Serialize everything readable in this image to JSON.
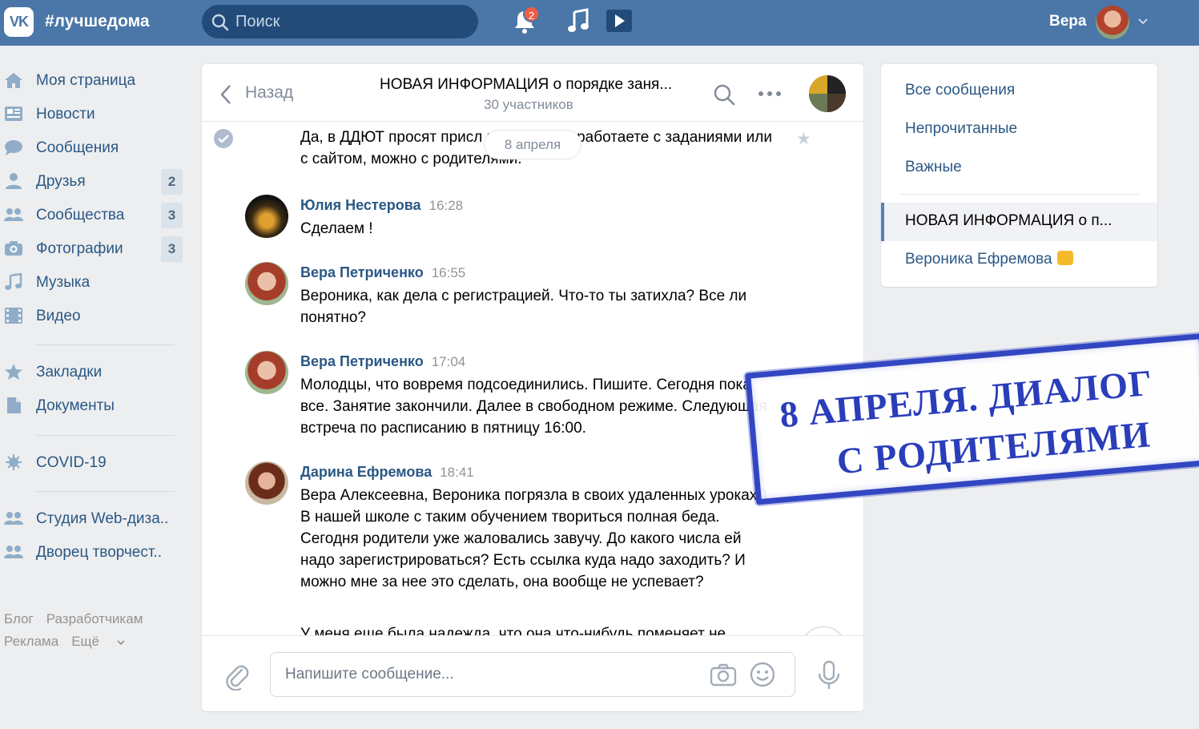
{
  "header": {
    "brand": "#лучшедома",
    "search_placeholder": "Поиск",
    "notifications_count": "2",
    "user_name": "Вера",
    "colors": {
      "bar": "#4a76a8",
      "search_bg": "#224b7a",
      "badge": "#f05c44"
    }
  },
  "sidebar": {
    "items": [
      {
        "label": "Моя страница",
        "icon": "home-icon"
      },
      {
        "label": "Новости",
        "icon": "news-icon"
      },
      {
        "label": "Сообщения",
        "icon": "chat-bubble-icon"
      },
      {
        "label": "Друзья",
        "icon": "person-icon",
        "count": "2"
      },
      {
        "label": "Сообщества",
        "icon": "group-icon",
        "count": "3"
      },
      {
        "label": "Фотографии",
        "icon": "camera-icon",
        "count": "3"
      },
      {
        "label": "Музыка",
        "icon": "music-icon"
      },
      {
        "label": "Видео",
        "icon": "video-film-icon"
      },
      {
        "label": "Закладки",
        "icon": "star-icon"
      },
      {
        "label": "Документы",
        "icon": "document-icon"
      },
      {
        "label": "COVID-19",
        "icon": "virus-icon"
      },
      {
        "label": "Студия Web-диза..",
        "icon": "group-icon"
      },
      {
        "label": "Дворец творчест..",
        "icon": "group-icon"
      }
    ],
    "footer": {
      "blog": "Блог",
      "developers": "Разработчикам",
      "ads": "Реклама",
      "more": "Ещё"
    }
  },
  "chat": {
    "back_label": "Назад",
    "title": "НОВАЯ ИНФОРМАЦИЯ  о порядке заня...",
    "subtitle": "30 участников",
    "date_pill": "8 апреля",
    "first_message_text": "Да, в ДДЮТ просят присл        как вы дома работаете с заданиями или с сайтом, можно с родителями.",
    "messages": [
      {
        "author": "Юлия Нестерова",
        "time": "16:28",
        "text": "Сделаем !"
      },
      {
        "author": "Вера Петриченко",
        "time": "16:55",
        "text": "Вероника, как дела с регистрацией. Что-то ты затихла? Все ли понятно?"
      },
      {
        "author": "Вера Петриченко",
        "time": "17:04",
        "text": "Молодцы, что вовремя подсоединились. Пишите. Сегодня пока все. Занятие закончили. Далее в свободном режиме. Следующая встреча по расписанию в пятницу 16:00."
      },
      {
        "author": "Дарина Ефремова",
        "time": "18:41",
        "text": "Вера Алексеевна, Вероника погрязла в своих удаленных уроках)) В нашей школе с таким обучением твориться полная беда. Сегодня родители уже жаловались завучу. До какого числа ей надо зарегистрироваться? Есть ссылка куда надо заходить? И можно мне за нее это сделать, она вообще не успевает?"
      }
    ],
    "cut_text": "У меня еще была надежда, что она что-нибудь поменяет не...",
    "composer_placeholder": "Напишите сообщение..."
  },
  "right_panel": {
    "all_messages": "Все сообщения",
    "unread": "Непрочитанные",
    "important": "Важные",
    "active_chat": "НОВАЯ ИНФОРМАЦИЯ  о п...",
    "other_chat": "Вероника Ефремова"
  },
  "stamp": {
    "line1": "8 АПРЕЛЯ.  ДИАЛОГ",
    "line2": "С РОДИТЕЛЯМИ",
    "color": "#2a3dba"
  }
}
